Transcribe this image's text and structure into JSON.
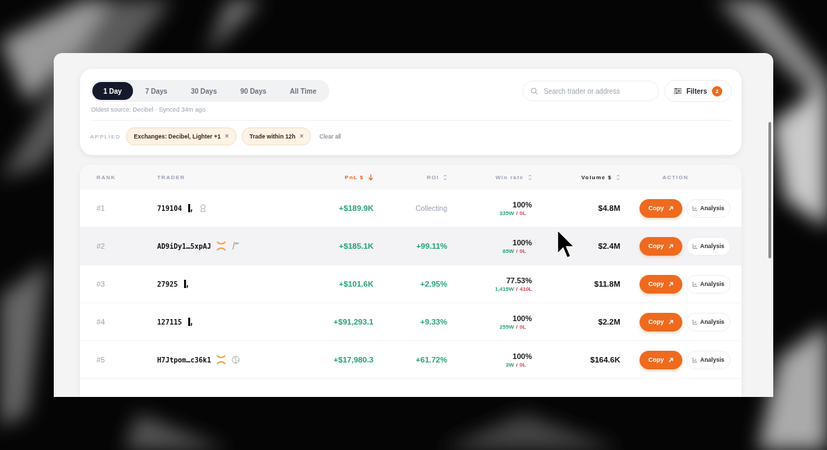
{
  "periods": [
    {
      "label": "1 Day",
      "selected": true
    },
    {
      "label": "7 Days",
      "selected": false
    },
    {
      "label": "30 Days",
      "selected": false
    },
    {
      "label": "90 Days",
      "selected": false
    },
    {
      "label": "All Time",
      "selected": false
    }
  ],
  "sync_note": "Oldest source: Decibel · Synced 34m ago",
  "search": {
    "placeholder": "Search trader or address"
  },
  "filters": {
    "label": "Filters",
    "count": "2"
  },
  "applied": {
    "label": "APPLIED",
    "chips": [
      {
        "label": "Exchanges: Decibel, Lighter +1",
        "remove": "×"
      },
      {
        "label": "Trade within 12h",
        "remove": "×"
      }
    ],
    "clear": "Clear all"
  },
  "columns": [
    {
      "label": "RANK",
      "sortable": false,
      "sorted": false,
      "strong": false
    },
    {
      "label": "TRADER",
      "sortable": false,
      "sorted": false,
      "strong": false
    },
    {
      "label": "PnL $",
      "sortable": true,
      "sorted": true,
      "strong": false
    },
    {
      "label": "ROI",
      "sortable": true,
      "sorted": false,
      "strong": false
    },
    {
      "label": "Win rate",
      "sortable": true,
      "sorted": false,
      "strong": false
    },
    {
      "label": "Volume $",
      "sortable": true,
      "sorted": false,
      "strong": true
    },
    {
      "label": "ACTION",
      "sortable": false,
      "sorted": false,
      "strong": false
    }
  ],
  "rows": [
    {
      "rank": "#1",
      "trader": "719104",
      "badges": [
        {
          "kind": "lighter"
        },
        {
          "kind": "medal"
        }
      ],
      "pnl": "+$189.9K",
      "roi": {
        "text": "Collecting",
        "kind": "pending"
      },
      "win_rate": "100%",
      "wins": "335W",
      "separator": "/",
      "losses": "0L",
      "volume": "$4.8M",
      "hovered": false,
      "copy": "Copy",
      "analysis": "Analysis"
    },
    {
      "rank": "#2",
      "trader": "AD9iDy1…5xpAJ",
      "badges": [
        {
          "kind": "cross"
        },
        {
          "kind": "flag"
        }
      ],
      "pnl": "+$185.1K",
      "roi": {
        "text": "+99.11%",
        "kind": "positive"
      },
      "win_rate": "100%",
      "wins": "85W",
      "separator": "/",
      "losses": "0L",
      "volume": "$2.4M",
      "hovered": true,
      "copy": "Copy",
      "analysis": "Analysis"
    },
    {
      "rank": "#3",
      "trader": "27925",
      "badges": [
        {
          "kind": "lighter"
        }
      ],
      "pnl": "+$101.6K",
      "roi": {
        "text": "+2.95%",
        "kind": "positive"
      },
      "win_rate": "77.53%",
      "wins": "1,415W",
      "separator": "/",
      "losses": "410L",
      "volume": "$11.8M",
      "hovered": false,
      "copy": "Copy",
      "analysis": "Analysis"
    },
    {
      "rank": "#4",
      "trader": "127115",
      "badges": [
        {
          "kind": "lighter"
        }
      ],
      "pnl": "+$91,293.1",
      "roi": {
        "text": "+9.33%",
        "kind": "positive"
      },
      "win_rate": "100%",
      "wins": "255W",
      "separator": "/",
      "losses": "0L",
      "volume": "$2.2M",
      "hovered": false,
      "copy": "Copy",
      "analysis": "Analysis"
    },
    {
      "rank": "#5",
      "trader": "H7Jtpom…c36k1",
      "badges": [
        {
          "kind": "cross"
        },
        {
          "kind": "brain"
        }
      ],
      "pnl": "+$17,980.3",
      "roi": {
        "text": "+61.72%",
        "kind": "positive"
      },
      "win_rate": "100%",
      "wins": "3W",
      "separator": "/",
      "losses": "0L",
      "volume": "$164.6K",
      "hovered": false,
      "copy": "Copy",
      "analysis": "Analysis"
    }
  ]
}
